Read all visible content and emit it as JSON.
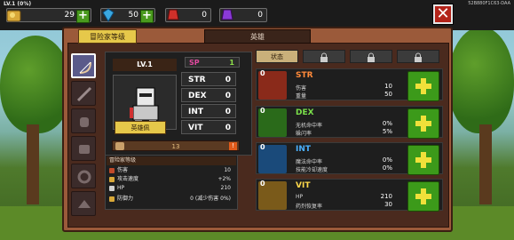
{
  "topbar": {
    "level": "LV.1 (0%)",
    "code": "52B880F1C63-DAA",
    "resources": [
      {
        "name": "gold",
        "value": "29",
        "color": "#d8a838"
      },
      {
        "name": "gems",
        "value": "50",
        "color": "#3aa8e0"
      },
      {
        "name": "red-crystal",
        "value": "0",
        "color": "#d0302a"
      },
      {
        "name": "purple-crystal",
        "value": "0",
        "color": "#8a3ad8"
      }
    ]
  },
  "tabs": {
    "adventurer": "冒险家等级",
    "hero": "英雄"
  },
  "hero": {
    "level": "LV.1",
    "class_label": "英雄佩",
    "sp_label": "SP",
    "sp_value": "1",
    "stats": [
      {
        "key": "STR",
        "value": "0"
      },
      {
        "key": "DEX",
        "value": "0"
      },
      {
        "key": "INT",
        "value": "0"
      },
      {
        "key": "VIT",
        "value": "0"
      }
    ],
    "gold_count": "13"
  },
  "info": {
    "header": "冒险家等级",
    "rows": [
      {
        "label": "伤害",
        "value": "10",
        "color": "#c04a2a"
      },
      {
        "label": "攻击速度",
        "value": "+2%",
        "color": "#d8a838"
      },
      {
        "label": "HP",
        "value": "210",
        "color": "#d0d0d0"
      },
      {
        "label": "防御力",
        "value": "0 (减少伤害 0%)",
        "color": "#d8a838"
      }
    ]
  },
  "right_tabs": [
    {
      "label": "状态",
      "locked": false
    },
    {
      "label": "lock-icon",
      "locked": true
    },
    {
      "label": "lock-icon",
      "locked": true
    },
    {
      "label": "lock-icon",
      "locked": true
    }
  ],
  "cards": [
    {
      "num": "0",
      "name": "STR",
      "name_color": "#ff8a3a",
      "art_color": "#8a2a1a",
      "rows": [
        {
          "label": "伤害",
          "value": "10"
        },
        {
          "label": "重量",
          "value": "50"
        }
      ]
    },
    {
      "num": "0",
      "name": "DEX",
      "name_color": "#7ae04a",
      "art_color": "#2a6a1a",
      "rows": [
        {
          "label": "无机命中率",
          "value": "0%"
        },
        {
          "label": "躲闪率",
          "value": "5%"
        }
      ]
    },
    {
      "num": "0",
      "name": "INT",
      "name_color": "#4ab0ff",
      "art_color": "#1a4a7a",
      "rows": [
        {
          "label": "魔法命中率",
          "value": "0%"
        },
        {
          "label": "技能冷却速度",
          "value": "0%"
        }
      ]
    },
    {
      "num": "0",
      "name": "VIT",
      "name_color": "#ffd84a",
      "art_color": "#7a5a1a",
      "rows": [
        {
          "label": "HP",
          "value": "210"
        },
        {
          "label": "药剂恢复率",
          "value": "30"
        }
      ]
    }
  ]
}
